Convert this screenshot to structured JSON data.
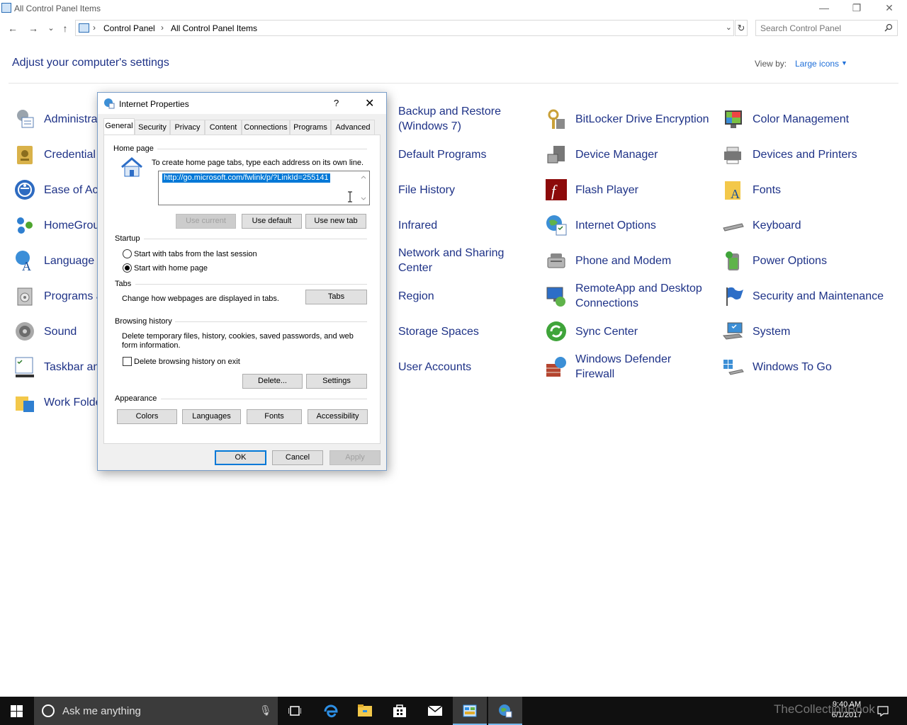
{
  "window": {
    "title": "All Control Panel Items",
    "minimize_glyph": "—",
    "restore_glyph": "❐",
    "close_glyph": "✕"
  },
  "nav": {
    "back_glyph": "←",
    "forward_glyph": "→",
    "recent_glyph": "⌄",
    "up_glyph": "↑"
  },
  "address": {
    "breadcrumbs": [
      "Control Panel",
      "All Control Panel Items"
    ],
    "separator": "›",
    "refresh_glyph": "↻"
  },
  "search": {
    "placeholder": "Search Control Panel"
  },
  "header": {
    "title": "Adjust your computer's settings",
    "view_by_label": "View by:",
    "view_by_value": "Large icons"
  },
  "items": {
    "col1": [
      {
        "label": "Administra",
        "icon": "administrative-tools-icon"
      },
      {
        "label": "Credential",
        "icon": "credential-manager-icon"
      },
      {
        "label": "Ease of Acc",
        "icon": "ease-of-access-icon"
      },
      {
        "label": "HomeGrou",
        "icon": "homegroup-icon"
      },
      {
        "label": "Language",
        "icon": "language-icon"
      },
      {
        "label": "Programs a",
        "icon": "programs-features-icon"
      },
      {
        "label": "Sound",
        "icon": "sound-icon"
      },
      {
        "label": "Taskbar an",
        "icon": "taskbar-icon"
      },
      {
        "label": "Work Folde",
        "icon": "work-folders-icon"
      }
    ],
    "col2": [
      {
        "label": "Backup and Restore (Windows 7)",
        "icon": "backup-restore-icon"
      },
      {
        "label": "Default Programs",
        "icon": "default-programs-icon"
      },
      {
        "label": "File History",
        "icon": "file-history-icon"
      },
      {
        "label": "Infrared",
        "icon": "infrared-icon"
      },
      {
        "label": "Network and Sharing Center",
        "icon": "network-sharing-icon"
      },
      {
        "label": "Region",
        "icon": "region-icon"
      },
      {
        "label": "Storage Spaces",
        "icon": "storage-spaces-icon"
      },
      {
        "label": "User Accounts",
        "icon": "user-accounts-icon"
      }
    ],
    "col3": [
      {
        "label": "BitLocker Drive Encryption",
        "icon": "bitlocker-icon"
      },
      {
        "label": "Device Manager",
        "icon": "device-manager-icon"
      },
      {
        "label": "Flash Player",
        "icon": "flash-player-icon"
      },
      {
        "label": "Internet Options",
        "icon": "internet-options-icon"
      },
      {
        "label": "Phone and Modem",
        "icon": "phone-modem-icon"
      },
      {
        "label": "RemoteApp and Desktop Connections",
        "icon": "remoteapp-icon"
      },
      {
        "label": "Sync Center",
        "icon": "sync-center-icon"
      },
      {
        "label": "Windows Defender Firewall",
        "icon": "firewall-icon"
      }
    ],
    "col4": [
      {
        "label": "Color Management",
        "icon": "color-management-icon"
      },
      {
        "label": "Devices and Printers",
        "icon": "devices-printers-icon"
      },
      {
        "label": "Fonts",
        "icon": "fonts-icon"
      },
      {
        "label": "Keyboard",
        "icon": "keyboard-icon"
      },
      {
        "label": "Power Options",
        "icon": "power-options-icon"
      },
      {
        "label": "Security and Maintenance",
        "icon": "security-maintenance-icon"
      },
      {
        "label": "System",
        "icon": "system-icon"
      },
      {
        "label": "Windows To Go",
        "icon": "windows-to-go-icon"
      }
    ]
  },
  "dialog": {
    "title": "Internet Properties",
    "help_glyph": "?",
    "close_glyph": "✕",
    "tabs": [
      "General",
      "Security",
      "Privacy",
      "Content",
      "Connections",
      "Programs",
      "Advanced"
    ],
    "active_tab": "General",
    "home_page": {
      "group_label": "Home page",
      "instruction": "To create home page tabs, type each address on its own line.",
      "url": "http://go.microsoft.com/fwlink/p/?LinkId=255141",
      "use_current": "Use current",
      "use_default": "Use default",
      "use_new_tab": "Use new tab"
    },
    "startup": {
      "group_label": "Startup",
      "option_last_session": "Start with tabs from the last session",
      "option_home_page": "Start with home page",
      "selected": "Start with home page"
    },
    "tabs_group": {
      "group_label": "Tabs",
      "description": "Change how webpages are displayed in tabs.",
      "button": "Tabs"
    },
    "browsing_history": {
      "group_label": "Browsing history",
      "description": "Delete temporary files, history, cookies, saved passwords, and web form information.",
      "delete_on_exit_label": "Delete browsing history on exit",
      "delete_on_exit_checked": false,
      "delete_button": "Delete...",
      "settings_button": "Settings"
    },
    "appearance": {
      "group_label": "Appearance",
      "colors": "Colors",
      "languages": "Languages",
      "fonts": "Fonts",
      "accessibility": "Accessibility"
    },
    "ok": "OK",
    "cancel": "Cancel",
    "apply": "Apply"
  },
  "taskbar": {
    "search_placeholder": "Ask me anything",
    "time": "9:40 AM",
    "date": "6/1/2017",
    "watermark": "TheCollectionBook"
  },
  "colors": {
    "link_blue": "#1e3287",
    "accent": "#0078d7",
    "taskbar": "#101010"
  }
}
